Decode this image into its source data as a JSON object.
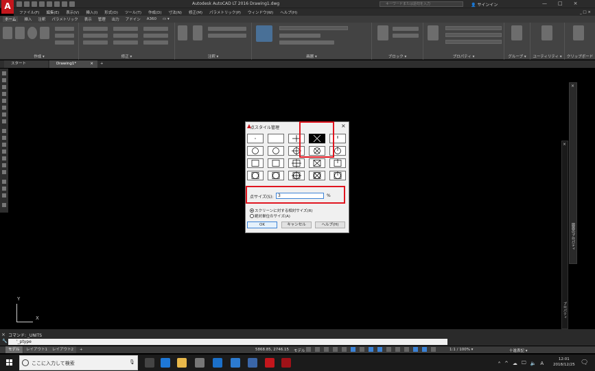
{
  "titlebar": {
    "logo": "A",
    "title": "Autodesk AutoCAD LT 2016   Drawing1.dwg",
    "search_placeholder": "キーワードまたは語句を入力",
    "signin": "サインイン",
    "controls": [
      "—",
      "□",
      "×"
    ]
  },
  "menubar": {
    "items": [
      "ファイル(F)",
      "編集(E)",
      "表示(V)",
      "挿入(I)",
      "形式(O)",
      "ツール(T)",
      "作成(D)",
      "寸法(N)",
      "修正(M)",
      "パラメトリック(P)",
      "ウィンドウ(W)",
      "ヘルプ(H)"
    ],
    "right": "_ □ ×"
  },
  "ribbon_tabs": [
    "ホーム",
    "挿入",
    "注釈",
    "パラメトリック",
    "表示",
    "管理",
    "出力",
    "アドイン",
    "A360",
    "▭ ▾"
  ],
  "ribbon_panels": [
    "作成 ▾",
    "修正 ▾",
    "注釈 ▾",
    "画層 ▾",
    "ブロック ▾",
    "プロパティ ▾",
    "グループ ▾",
    "ユーティリティ ▾",
    "クリップボード"
  ],
  "doc_tabs": {
    "start": "スタート",
    "drawing": "Drawing1*",
    "close": "×",
    "plus": "+"
  },
  "ucs": {
    "x": "X",
    "y": "Y"
  },
  "right_palette": {
    "label": "図面のプロパティ",
    "label2": "プロパティ",
    "close": "×"
  },
  "command": {
    "history": "コマンド: _UNITS",
    "input": "'_ptype",
    "close": "×",
    "wrench": "🔧"
  },
  "layout_tabs": [
    "モデル",
    "レイアウト1",
    "レイアウト2",
    "+"
  ],
  "status": {
    "coords": "5868.85, 2746.15",
    "space": "モデル",
    "scale": "1:1 / 100% ▾",
    "units": "十進表記 ▾"
  },
  "taskbar": {
    "search_text": "ここに入力して検索",
    "tray": [
      "ᴬ",
      "^",
      "☁",
      "🖵",
      "🔈",
      "A"
    ],
    "time": "12:01",
    "date": "2018/12/25",
    "notif": "🗨"
  },
  "dialog": {
    "title": "点スタイル管理",
    "close": "×",
    "point_size_label": "点サイズ(S):",
    "point_size_value": "3",
    "unit": "%",
    "radio1": "スクリーンに対する相対サイズ(R)",
    "radio2": "絶対単位のサイズ(A)",
    "ok": "OK",
    "cancel": "キャンセル",
    "help": "ヘルプ(H)"
  },
  "colors": {
    "accent_red": "#e0141e",
    "autodesk_red": "#c4161c",
    "selection_blue": "#3b82d6"
  }
}
